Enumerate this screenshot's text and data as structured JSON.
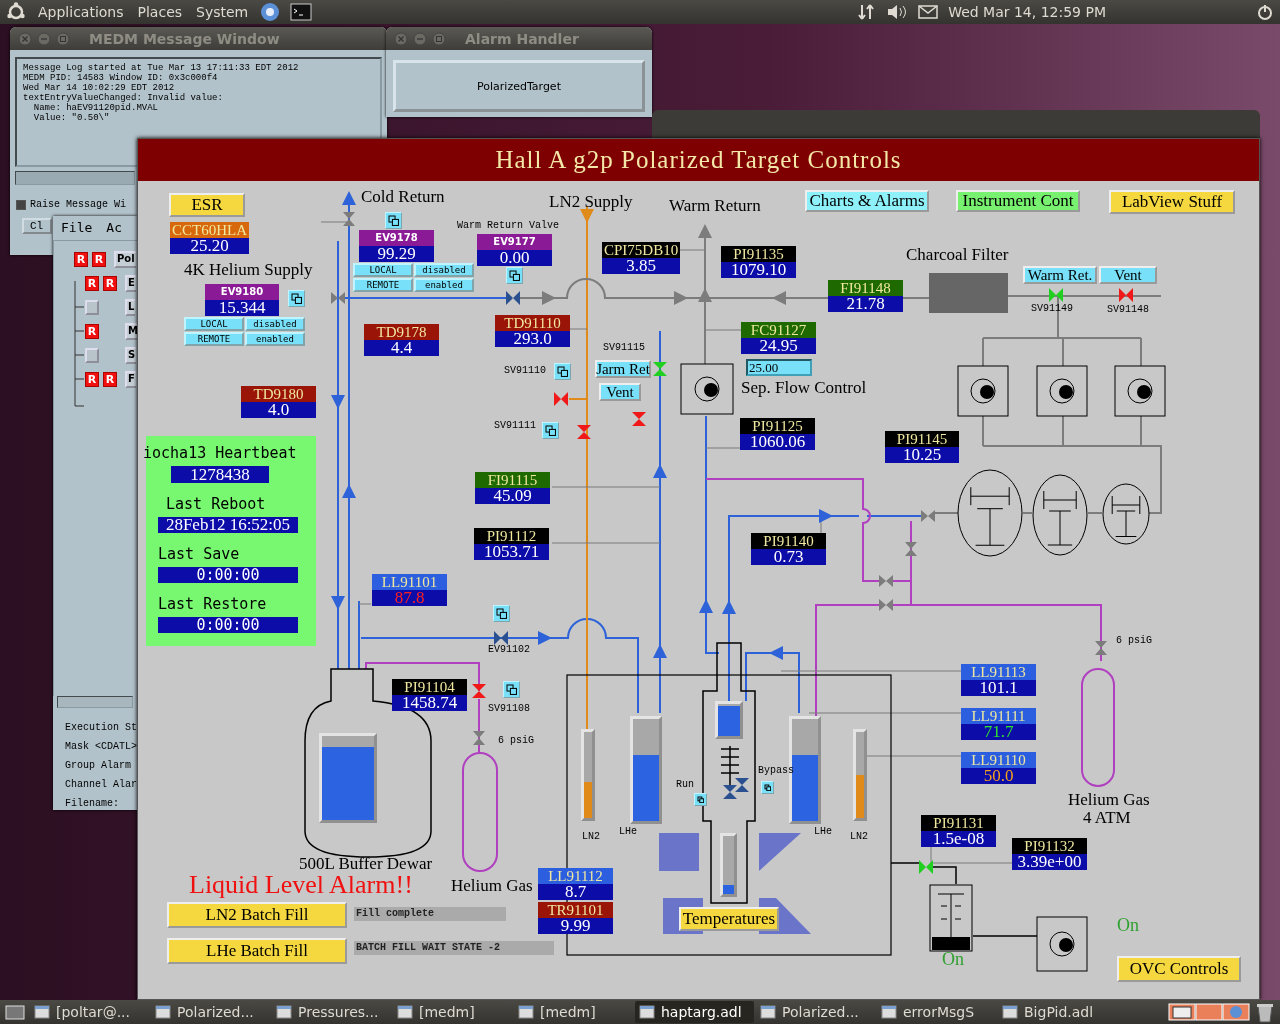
{
  "top_panel": {
    "menus": [
      "Applications",
      "Places",
      "System"
    ],
    "clock": "Wed Mar 14, 12:59 PM"
  },
  "message_window": {
    "title": "MEDM Message Window",
    "log": [
      "Message Log started at Tue Mar 13 17:11:33 EDT 2012",
      "MEDM PID: 14583 Window ID: 0x3c000f4",
      "Wed Mar 14 10:02:29 EDT 2012",
      "textEntryValueChanged: Invalid value:",
      "  Name: haEV91120pid.MVAL",
      "  Value: \"0.50\\\""
    ],
    "checkbox": {
      "label": "Raise Message Wi",
      "checked": true
    },
    "button": "Cl"
  },
  "alarm_handler": {
    "title": "Alarm Handler",
    "group": "PolarizedTarget"
  },
  "alarm_tree": {
    "menus": [
      "File",
      "Ac"
    ],
    "root": {
      "label": "Pol",
      "marks": [
        "R",
        "R"
      ],
      "children": [
        {
          "label": "E",
          "marks": [
            "R",
            "R"
          ]
        },
        {
          "label": "L"
        },
        {
          "label": "M",
          "marks": [
            "R"
          ]
        },
        {
          "label": "S"
        },
        {
          "label": "F",
          "marks": [
            "R",
            "R"
          ]
        }
      ]
    },
    "status_lines": [
      "Execution St",
      "Mask <CDATL>",
      "Group Alarm",
      "Channel Alar",
      "Filename:"
    ]
  },
  "main_window": {
    "title": "Hall A g2p Polarized Target Controls",
    "nav_buttons": [
      {
        "label": "ESR",
        "color": "#f5d840"
      },
      {
        "label": "Charts & Alarms",
        "color": "#8ef0f8"
      },
      {
        "label": "Instrument Cont",
        "color": "#78f070"
      },
      {
        "label": "LabView Stuff",
        "color": "#f5d840"
      },
      {
        "label": "Temperatures",
        "color": "#f5d840"
      },
      {
        "label": "OVC Controls",
        "color": "#f5d840"
      },
      {
        "label": "LN2 Batch Fill",
        "color": "#f5d840"
      },
      {
        "label": "LHe Batch Fill",
        "color": "#f5d840"
      }
    ],
    "valve_buttons": [
      {
        "label": "Warm Ret.",
        "color": "#78e0f8"
      },
      {
        "label": "Vent",
        "color": "#78e0f8"
      },
      {
        "label": "Jarm Ret",
        "color": "#78e0f8"
      },
      {
        "label": "Vent",
        "color": "#78e0f8"
      }
    ],
    "mode_panels": [
      {
        "buttons": [
          "LOCAL",
          "disabled",
          "REMOTE",
          "enabled"
        ]
      },
      {
        "buttons": [
          "LOCAL",
          "disabled",
          "REMOTE",
          "enabled"
        ]
      }
    ],
    "readouts": [
      {
        "kind": "sensor",
        "label": "CCT60HLA",
        "value": "25.20",
        "color": "#d8680c"
      },
      {
        "kind": "valve",
        "label": "EV9180",
        "value": "15.344",
        "color": "#8a1a96"
      },
      {
        "kind": "valve",
        "label": "EV9178",
        "value": "99.29",
        "color": "#8a1a96"
      },
      {
        "kind": "valve",
        "label": "EV9177",
        "value": "0.00",
        "color": "#8a1a96"
      },
      {
        "kind": "sensor",
        "label": "CPI75DB10",
        "value": "3.85",
        "color": "#000000"
      },
      {
        "kind": "sensor",
        "label": "PI91135",
        "value": "1079.10",
        "color": "#000000"
      },
      {
        "kind": "sensor",
        "label": "FI91148",
        "value": "21.78",
        "color": "#1e6a00"
      },
      {
        "kind": "sensor",
        "label": "TD9178",
        "value": "4.4",
        "color": "#9a1408"
      },
      {
        "kind": "sensor",
        "label": "TD91110",
        "value": "293.0",
        "color": "#9a1408"
      },
      {
        "kind": "sensor",
        "label": "FC91127",
        "value": "24.95",
        "color": "#1e6a00"
      },
      {
        "kind": "sensor",
        "label": "TD9180",
        "value": "4.0",
        "color": "#9a1408"
      },
      {
        "kind": "sensor",
        "label": "PI91125",
        "value": "1060.06",
        "color": "#000000"
      },
      {
        "kind": "sensor",
        "label": "PI91145",
        "value": "10.25",
        "color": "#000000"
      },
      {
        "kind": "sensor",
        "label": "FI91115",
        "value": "45.09",
        "color": "#1e6a00"
      },
      {
        "kind": "sensor",
        "label": "PI91112",
        "value": "1053.71",
        "color": "#000000"
      },
      {
        "kind": "sensor",
        "label": "PI91140",
        "value": "0.73",
        "color": "#000000"
      },
      {
        "kind": "major",
        "label": "LL91101",
        "value": "87.8",
        "color": "#2c5ee0"
      },
      {
        "kind": "sensor",
        "label": "PI91104",
        "value": "1458.74",
        "color": "#000000"
      },
      {
        "kind": "sensor",
        "label": "LL91113",
        "value": "101.1",
        "color": "#2c5ee0"
      },
      {
        "kind": "ok",
        "label": "LL91111",
        "value": "71.7",
        "color": "#2c5ee0"
      },
      {
        "kind": "minor",
        "label": "LL91110",
        "value": "50.0",
        "color": "#2c5ee0"
      },
      {
        "kind": "sensor",
        "label": "PI91131",
        "value": "1.5e-08",
        "color": "#000000"
      },
      {
        "kind": "sensor",
        "label": "PI91132",
        "value": "3.39e+00",
        "color": "#000000"
      },
      {
        "kind": "sensor",
        "label": "LL91112",
        "value": "8.7",
        "color": "#2c5ee0"
      },
      {
        "kind": "sensor",
        "label": "TR91101",
        "value": "9.99",
        "color": "#9a1408"
      }
    ],
    "valves": [
      {
        "label": "SV91115",
        "open": true
      },
      {
        "label": "SV91110",
        "open": false
      },
      {
        "label": "SV91111",
        "open": false
      },
      {
        "open": false
      },
      {
        "label": "SV91149",
        "open": true
      },
      {
        "label": "SV91148",
        "open": false
      },
      {
        "label": "SV91108",
        "open": false
      },
      {
        "open": true
      }
    ],
    "gauges": [
      {
        "level": 0.87,
        "color": "#2b63e0"
      },
      {
        "label": "LN2",
        "level": 0.42,
        "color": "#e08a1a"
      },
      {
        "label": "LHe",
        "level": 0.65,
        "color": "#2b63e0"
      },
      {
        "level": 0.95,
        "color": "#2b63e0"
      },
      {
        "level": 0.15,
        "color": "#2b63e0"
      },
      {
        "label": "LHe",
        "level": 0.65,
        "color": "#2b63e0"
      },
      {
        "label": "LN2",
        "level": 0.5,
        "color": "#e08a1a"
      }
    ],
    "labels": [
      {
        "kind": "caption",
        "text": "Cold Return"
      },
      {
        "kind": "caption",
        "text": "LN2 Supply"
      },
      {
        "kind": "caption",
        "text": "Warm Return"
      },
      {
        "kind": "caption",
        "text": "4K Helium Supply"
      },
      {
        "kind": "tag",
        "text": "Warm Return Valve"
      },
      {
        "kind": "caption",
        "text": "Charcoal Filter"
      },
      {
        "kind": "caption",
        "text": "Sep. Flow Control"
      },
      {
        "kind": "tag",
        "text": "EV91102"
      },
      {
        "kind": "tag",
        "text": "6 psiG"
      },
      {
        "kind": "tag",
        "text": "6 psiG"
      },
      {
        "kind": "caption",
        "text": "500L Buffer Dewar"
      },
      {
        "kind": "caption",
        "text": "Helium Gas"
      },
      {
        "kind": "caption",
        "text": "Helium Gas"
      },
      {
        "kind": "caption",
        "text": "4 ATM"
      },
      {
        "kind": "tag",
        "text": "Run"
      },
      {
        "kind": "tag",
        "text": "Bypass"
      },
      {
        "kind": "alarm",
        "text": "Liquid Level Alarm!!"
      },
      {
        "kind": "status",
        "text": "On"
      },
      {
        "kind": "status",
        "text": "On"
      }
    ],
    "setpoint": {
      "value": "25.00"
    },
    "status_fields": [
      "Fill complete",
      "BATCH FILL WAIT STATE -2"
    ],
    "heartbeat": {
      "title": "iocha13 Heartbeat",
      "counter": "1278438",
      "rows": [
        {
          "label": "Last Reboot",
          "value": "28Feb12 16:52:05"
        },
        {
          "label": "Last Save",
          "value": "0:00:00"
        },
        {
          "label": "Last Restore",
          "value": "0:00:00"
        }
      ]
    }
  },
  "taskbar": {
    "items": [
      {
        "label": "[poltar@...",
        "selected": false
      },
      {
        "label": "Polarized...",
        "selected": false
      },
      {
        "label": "Pressures...",
        "selected": false
      },
      {
        "label": "[medm]",
        "selected": false
      },
      {
        "label": "[medm]",
        "selected": false
      },
      {
        "label": "haptarg.adl",
        "selected": true
      },
      {
        "label": "Polarized...",
        "selected": false
      },
      {
        "label": "errorMsgS",
        "selected": false
      },
      {
        "label": "BigPid.adl",
        "selected": false
      }
    ]
  }
}
